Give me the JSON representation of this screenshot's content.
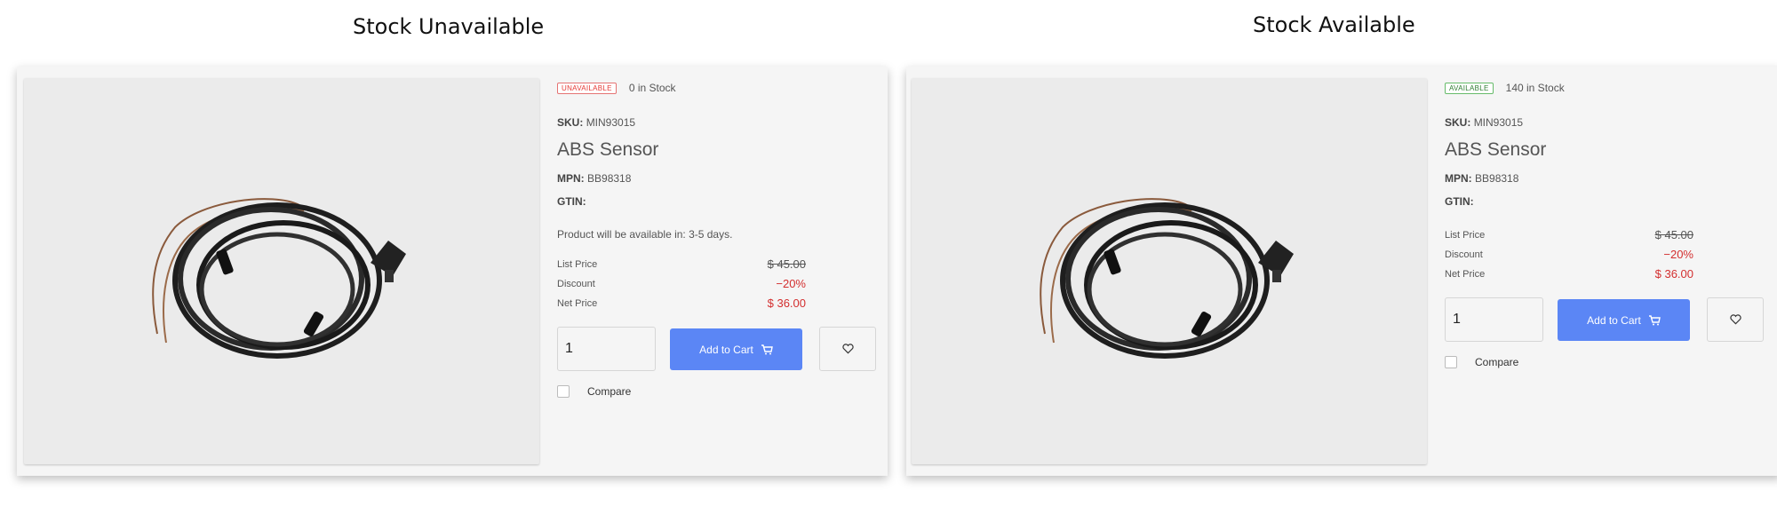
{
  "panels": [
    {
      "heading": "Stock Unavailable",
      "badge": "UNAVAILABLE",
      "stock_text": "0 in Stock",
      "sku_label": "SKU:",
      "sku": "MIN93015",
      "product_name": "ABS Sensor",
      "mpn_label": "MPN:",
      "mpn": "BB98318",
      "gtin_label": "GTIN:",
      "gtin": "",
      "availability_note": "Product will be available in: 3-5 days.",
      "list_price_label": "List Price",
      "list_price": "$ 45.00",
      "discount_label": "Discount",
      "discount": "−20%",
      "net_price_label": "Net Price",
      "net_price": "$ 36.00",
      "quantity": "1",
      "add_to_cart_label": "Add to Cart",
      "compare_label": "Compare"
    },
    {
      "heading": "Stock Available",
      "badge": "AVAILABLE",
      "stock_text": "140 in Stock",
      "sku_label": "SKU:",
      "sku": "MIN93015",
      "product_name": "ABS Sensor",
      "mpn_label": "MPN:",
      "mpn": "BB98318",
      "gtin_label": "GTIN:",
      "gtin": "",
      "list_price_label": "List Price",
      "list_price": "$ 45.00",
      "discount_label": "Discount",
      "discount": "−20%",
      "net_price_label": "Net Price",
      "net_price": "$ 36.00",
      "quantity": "1",
      "add_to_cart_label": "Add to Cart",
      "compare_label": "Compare"
    }
  ],
  "colors": {
    "accent": "#5b86f5",
    "price_red": "#d32f2f",
    "unavailable": "#e53935",
    "available": "#2e7d32"
  },
  "icons": [
    "cart-icon",
    "heart-icon",
    "product-image-cable"
  ]
}
